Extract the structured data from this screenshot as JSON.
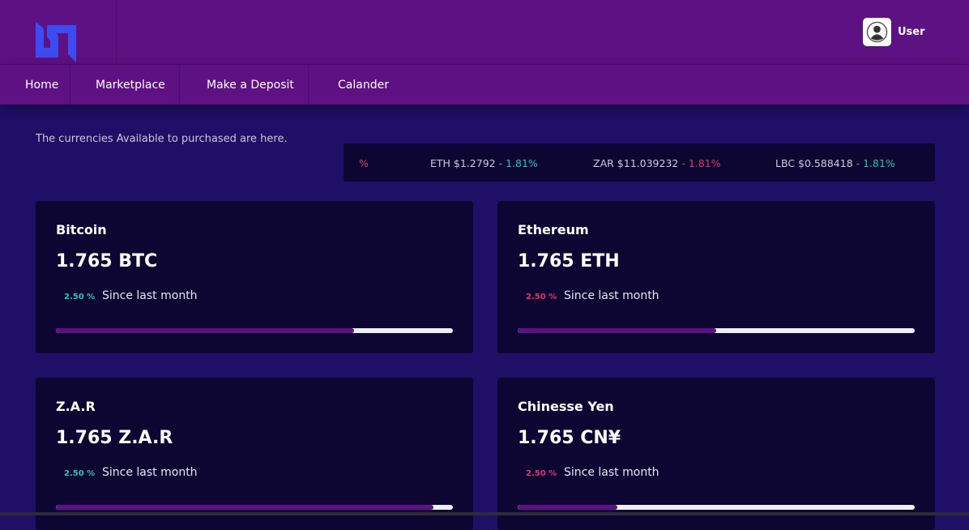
{
  "header": {
    "user_label": "User"
  },
  "nav": [
    {
      "label": "Home"
    },
    {
      "label": "Marketplace"
    },
    {
      "label": "Make a Deposit"
    },
    {
      "label": "Calander"
    }
  ],
  "intro": "The currencies Available to purchased are here.",
  "ticker": [
    {
      "symbol": "",
      "price": "",
      "change": "%",
      "direction": "down"
    },
    {
      "symbol": "ETH",
      "price": "$1.2792",
      "change": "1.81%",
      "direction": "up"
    },
    {
      "symbol": "ZAR",
      "price": "$11.039232",
      "change": "1.81%",
      "direction": "down"
    },
    {
      "symbol": "LBC",
      "price": "$0.588418",
      "change": "1.81%",
      "direction": "up"
    }
  ],
  "cards": [
    {
      "name": "Bitcoin",
      "amount": "1.765 BTC",
      "change": "2.50 %",
      "direction": "up",
      "since": "Since last month",
      "progress": 75
    },
    {
      "name": "Ethereum",
      "amount": "1.765 ETH",
      "change": "2.50 %",
      "direction": "down",
      "since": "Since last month",
      "progress": 50
    },
    {
      "name": "Z.A.R",
      "amount": "1.765 Z.A.R",
      "change": "2.50 %",
      "direction": "up",
      "since": "Since last month",
      "progress": 95
    },
    {
      "name": "Chinesse Yen",
      "amount": "1.765 CN¥",
      "change": "2.50 %",
      "direction": "down",
      "since": "Since last month",
      "progress": 25
    }
  ],
  "colors": {
    "header": "#5e1183",
    "background": "#1f0f66",
    "card": "#0d0532",
    "up": "#1cc8b0",
    "down": "#e0336e",
    "logo": "#3d4cf0"
  }
}
